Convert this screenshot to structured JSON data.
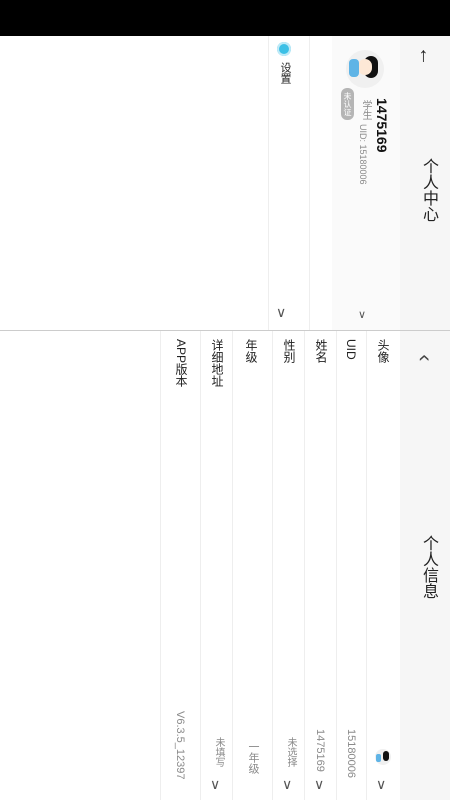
{
  "personal_center": {
    "back_icon": "arrow-left-icon",
    "title": "个人中心",
    "username": "1475169",
    "role": "学生",
    "uid_text": "UID: 15180006",
    "badge": "未认证",
    "settings_label": "设置",
    "accent": "#3cc0e6"
  },
  "personal_info": {
    "title": "个人信息",
    "fields": [
      {
        "label": "头像",
        "value": ""
      },
      {
        "label": "UID",
        "value": "15180006"
      },
      {
        "label": "姓名",
        "value": "1475169"
      },
      {
        "label": "性别",
        "value": "未选择"
      },
      {
        "label": "年级",
        "value": "一年级"
      },
      {
        "label": "详细地址",
        "value": "未填写"
      },
      {
        "label": "APP版本",
        "value": "V6.3.5_12397"
      }
    ]
  }
}
